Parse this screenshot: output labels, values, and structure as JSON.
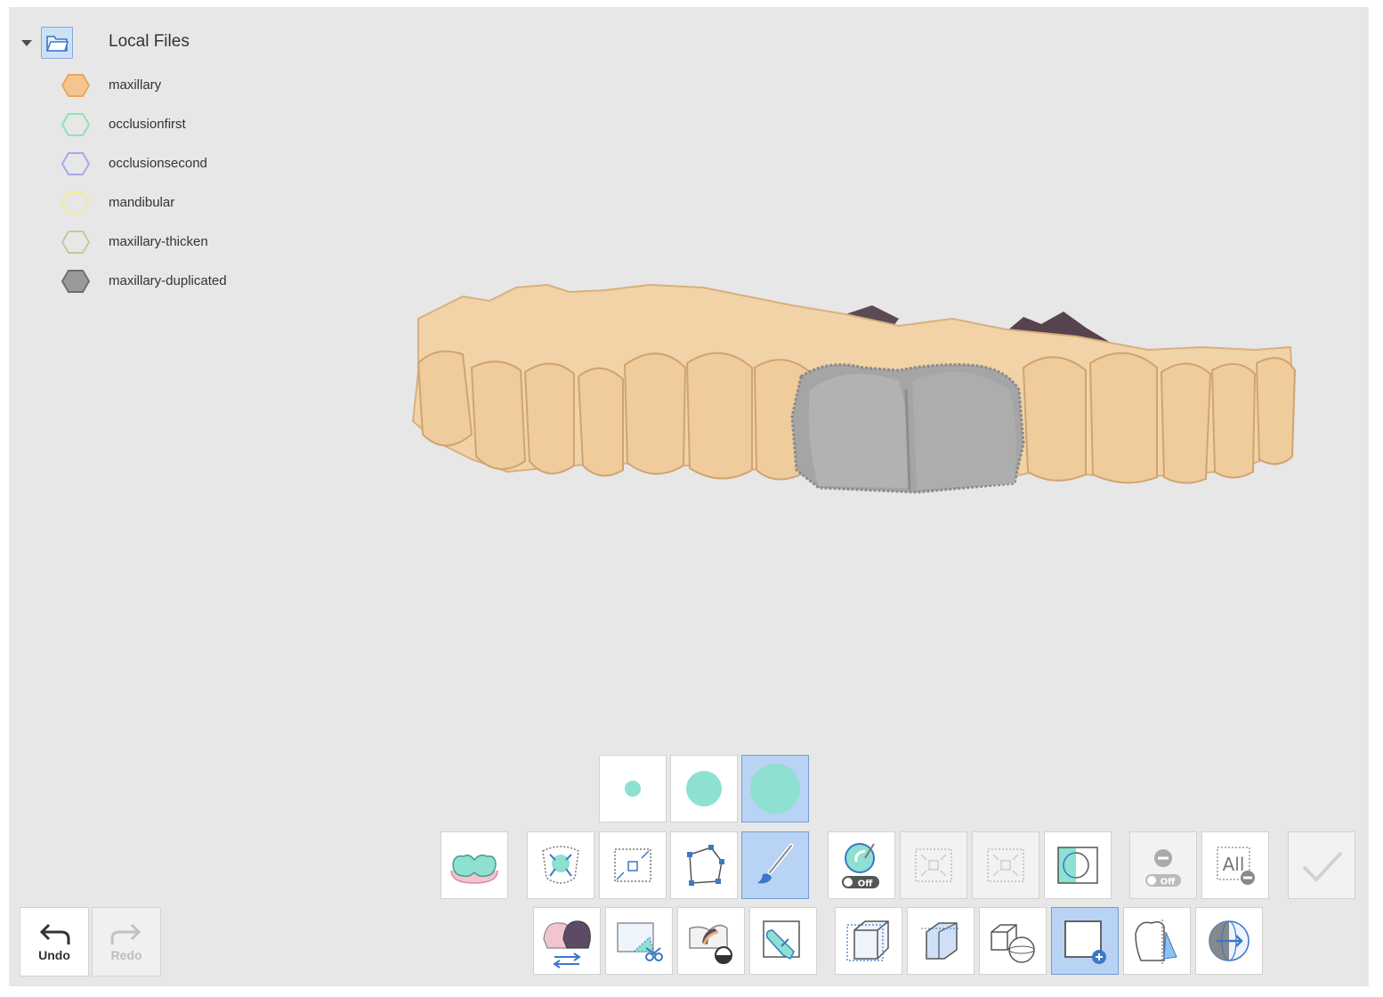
{
  "file_tree": {
    "root_label": "Local Files",
    "items": [
      {
        "label": "maxillary",
        "stroke": "#e7a762",
        "fill": "#f6c48e"
      },
      {
        "label": "occlusionfirst",
        "stroke": "#8fe3b6",
        "fill": "none"
      },
      {
        "label": "occlusionsecond",
        "stroke": "#a7a9ef",
        "fill": "none"
      },
      {
        "label": "mandibular",
        "stroke": "#f0ec98",
        "fill": "none"
      },
      {
        "label": "maxillary-thicken",
        "stroke": "#b9d09a",
        "fill": "none"
      },
      {
        "label": "maxillary-duplicated",
        "stroke": "#6f6f6f",
        "fill": "#9a9a9a"
      }
    ]
  },
  "history": {
    "undo_label": "Undo",
    "redo_label": "Redo"
  },
  "toolbar": {
    "off_text": "Off",
    "all_text": "All"
  },
  "colors": {
    "accent": "#b8d3f4",
    "tool_teal": "#8ee0d0",
    "gum": "#f2c4cf",
    "tooth": "#f2d3a7",
    "selection": "#a5a5a5"
  }
}
